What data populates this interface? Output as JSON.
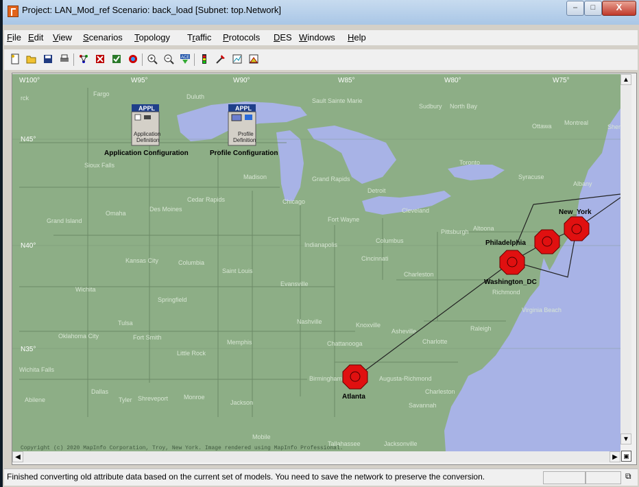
{
  "window": {
    "title": "Project: LAN_Mod_ref Scenario: back_load  [Subnet: top.Network]",
    "controls": {
      "minimize": "–",
      "maximize": "□",
      "close": "X"
    }
  },
  "menu": {
    "items": [
      {
        "key": "F",
        "rest": "ile"
      },
      {
        "key": "E",
        "rest": "dit"
      },
      {
        "key": "V",
        "rest": "iew"
      },
      {
        "key": "S",
        "rest": "cenarios"
      },
      {
        "key": "T",
        "rest": "opology"
      },
      {
        "key": "T",
        "rest": "raffic",
        "split": "r"
      },
      {
        "key": "P",
        "rest": "rotocols"
      },
      {
        "key": "D",
        "rest": "ES"
      },
      {
        "key": "W",
        "rest": "indows"
      },
      {
        "key": "H",
        "rest": "elp"
      }
    ]
  },
  "toolbar": {
    "icons": [
      "new-icon",
      "open-icon",
      "save-icon",
      "print-icon",
      "rapid-config-icon",
      "fail-node-icon",
      "recover-node-icon",
      "node-model-icon",
      "zoom-in-icon",
      "zoom-out-icon",
      "ace-import-icon",
      "configure-des-icon",
      "discrete-event-run-icon",
      "view-results-icon",
      "edit-graph-icon"
    ]
  },
  "map": {
    "longitude_labels": [
      "W100°",
      "W95°",
      "W90°",
      "W85°",
      "W80°",
      "W75°"
    ],
    "latitude_labels": [
      "N45°",
      "N40°",
      "N35°"
    ],
    "cities": [
      "Fargo",
      "Duluth",
      "Sault Sainte Marie",
      "Sudbury",
      "North Bay",
      "Ottawa",
      "Montreal",
      "Sher",
      "Sioux Falls",
      "Madison",
      "Grand Rapids",
      "Toronto",
      "Syracuse",
      "Albany",
      "Cedar Rapids",
      "Detroit",
      "Des Moines",
      "Omaha",
      "Chicago",
      "Cleveland",
      "Grand Island",
      "Fort Wayne",
      "Pittsburgh",
      "Altoona",
      "Columbus",
      "Indianapolis",
      "Kansas City",
      "Columbia",
      "Cincinnati",
      "Saint Louis",
      "Charleston",
      "Wichita",
      "Evansville",
      "Springfield",
      "Richmond",
      "Virginia Beach",
      "Tulsa",
      "Nashville",
      "Knoxville",
      "Asheville",
      "Raleigh",
      "Oklahoma City",
      "Fort Smith",
      "Memphis",
      "Chattanooga",
      "Charlotte",
      "Little Rock",
      "Wichita Falls",
      "Birmingham",
      "Augusta-Richmond",
      "Dallas",
      "Abilene",
      "Tyler",
      "Shreveport",
      "Monroe",
      "Jackson",
      "Charleston",
      "Savannah",
      "Mobile",
      "Tallahassee",
      "Jacksonville",
      "rck"
    ],
    "copyright": "Copyright (c) 2020 MapInfo Corporation, Troy, New York. Image rendered using MapInfo Professional.",
    "nodes": {
      "app_config": {
        "badge": "APPL",
        "body": "Application Definition",
        "label": "Application Configuration"
      },
      "profile_config": {
        "badge": "APPL",
        "body": "Profile Definition",
        "label": "Profile Configuration"
      },
      "routers": [
        "New_York",
        "Philadelphia",
        "Washington_DC",
        "Atlanta"
      ]
    },
    "colors": {
      "land": "#8dae86",
      "water": "#a8b3e6",
      "router": "#e01010",
      "link": "#222222",
      "border": "#5e7a5a"
    }
  },
  "status": {
    "message": "Finished converting old attribute data based on the current set of models.  You need to save the network to preserve the conversion."
  }
}
